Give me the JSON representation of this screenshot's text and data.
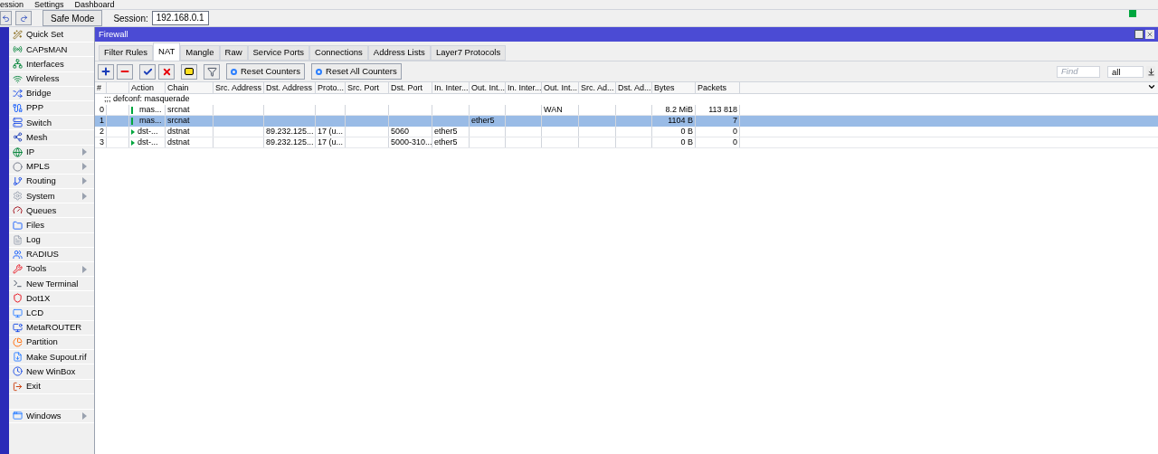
{
  "menu_bar": [
    "ession",
    "Settings",
    "Dashboard"
  ],
  "toolbar": {
    "safe_mode": "Safe Mode",
    "session_label": "Session:",
    "session_value": "192.168.0.1"
  },
  "sidebar": {
    "items": [
      {
        "label": "Quick Set",
        "submenu": false
      },
      {
        "label": "CAPsMAN",
        "submenu": false
      },
      {
        "label": "Interfaces",
        "submenu": false
      },
      {
        "label": "Wireless",
        "submenu": false
      },
      {
        "label": "Bridge",
        "submenu": false
      },
      {
        "label": "PPP",
        "submenu": false
      },
      {
        "label": "Switch",
        "submenu": false
      },
      {
        "label": "Mesh",
        "submenu": false
      },
      {
        "label": "IP",
        "submenu": true
      },
      {
        "label": "MPLS",
        "submenu": true
      },
      {
        "label": "Routing",
        "submenu": true
      },
      {
        "label": "System",
        "submenu": true
      },
      {
        "label": "Queues",
        "submenu": false
      },
      {
        "label": "Files",
        "submenu": false
      },
      {
        "label": "Log",
        "submenu": false
      },
      {
        "label": "RADIUS",
        "submenu": false
      },
      {
        "label": "Tools",
        "submenu": true
      },
      {
        "label": "New Terminal",
        "submenu": false
      },
      {
        "label": "Dot1X",
        "submenu": false
      },
      {
        "label": "LCD",
        "submenu": false
      },
      {
        "label": "MetaROUTER",
        "submenu": false
      },
      {
        "label": "Partition",
        "submenu": false
      },
      {
        "label": "Make Supout.rif",
        "submenu": false
      },
      {
        "label": "New WinBox",
        "submenu": false
      },
      {
        "label": "Exit",
        "submenu": false
      }
    ],
    "bottom_item": {
      "label": "Windows",
      "submenu": true
    }
  },
  "window": {
    "title": "Firewall"
  },
  "tabs": [
    {
      "label": "Filter Rules",
      "selected": false
    },
    {
      "label": "NAT",
      "selected": true
    },
    {
      "label": "Mangle",
      "selected": false
    },
    {
      "label": "Raw",
      "selected": false
    },
    {
      "label": "Service Ports",
      "selected": false
    },
    {
      "label": "Connections",
      "selected": false
    },
    {
      "label": "Address Lists",
      "selected": false
    },
    {
      "label": "Layer7 Protocols",
      "selected": false
    }
  ],
  "actions": [
    "Reset Counters",
    "Reset All Counters"
  ],
  "find": {
    "placeholder": "Find",
    "filter": "all"
  },
  "table": {
    "columns": [
      "#",
      "",
      "Action",
      "Chain",
      "Src. Address",
      "Dst. Address",
      "Proto...",
      "Src. Port",
      "Dst. Port",
      "In. Inter...",
      "Out. Int...",
      "In. Inter...",
      "Out. Int...",
      "Src. Ad...",
      "Dst. Ad...",
      "Bytes",
      "Packets"
    ],
    "comment": ";;; defconf: masquerade",
    "rows": [
      {
        "selected": false,
        "kind": "masquerade",
        "cells": [
          "0",
          "",
          "mas...",
          "srcnat",
          "",
          "",
          "",
          "",
          "",
          "",
          "",
          "",
          "WAN",
          "",
          "",
          "8.2 MiB",
          "113 818"
        ]
      },
      {
        "selected": true,
        "kind": "masquerade",
        "cells": [
          "1",
          "",
          "mas...",
          "srcnat",
          "",
          "",
          "",
          "",
          "",
          "",
          "ether5",
          "",
          "",
          "",
          "",
          "1104 B",
          "7"
        ]
      },
      {
        "selected": false,
        "kind": "dstnat",
        "cells": [
          "2",
          "",
          "dst-...",
          "dstnat",
          "",
          "89.232.125...",
          "17 (u...",
          "",
          "5060",
          "ether5",
          "",
          "",
          "",
          "",
          "",
          "0 B",
          "0"
        ]
      },
      {
        "selected": false,
        "kind": "dstnat",
        "cells": [
          "3",
          "",
          "dst-...",
          "dstnat",
          "",
          "89.232.125...",
          "17 (u...",
          "",
          "5000-310...",
          "ether5",
          "",
          "",
          "",
          "",
          "",
          "0 B",
          "0"
        ]
      }
    ]
  }
}
